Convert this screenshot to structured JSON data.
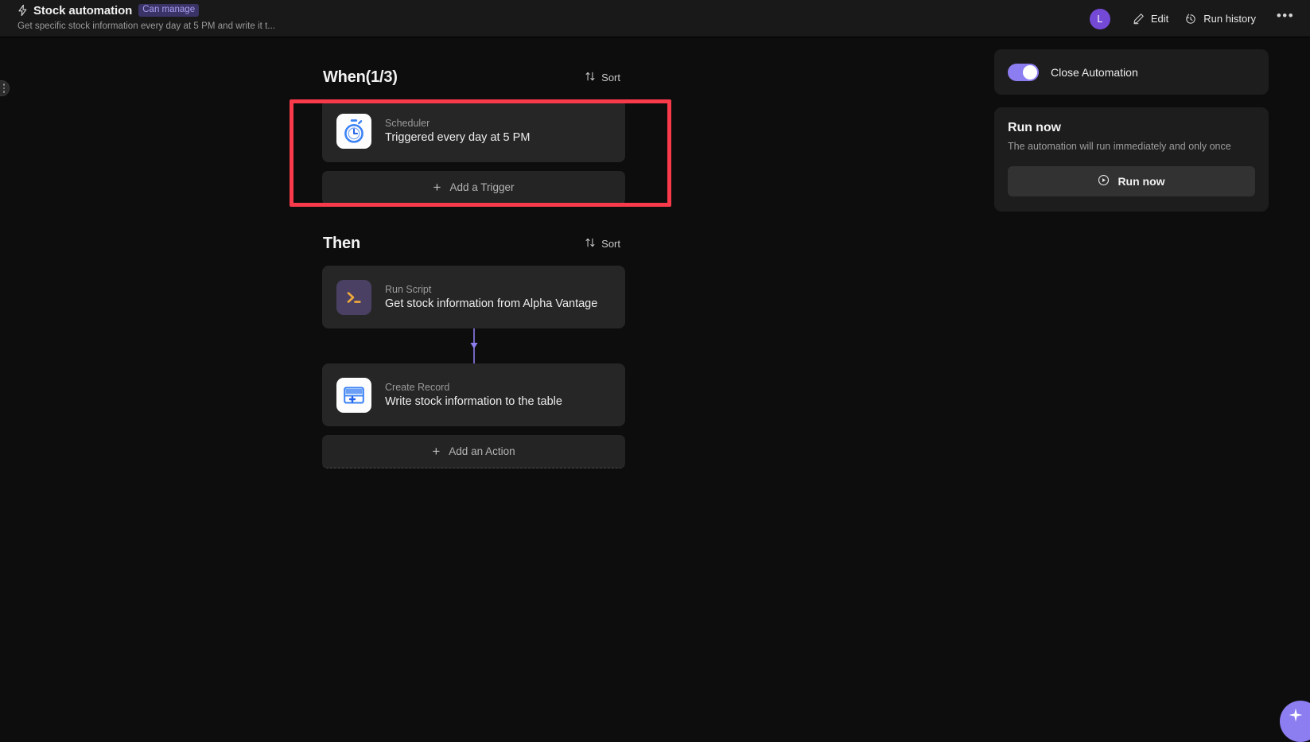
{
  "header": {
    "bolt_icon": "bolt-icon",
    "title": "Stock automation",
    "permission_badge": "Can manage",
    "subtitle": "Get specific stock information every day at 5 PM and write it t...",
    "avatar_initial": "L",
    "edit_label": "Edit",
    "run_history_label": "Run history",
    "more_label": "•••"
  },
  "flow": {
    "when": {
      "heading": "When(1/3)",
      "sort_label": "Sort",
      "triggers": [
        {
          "icon": "stopwatch-icon",
          "kind": "Scheduler",
          "description": "Triggered every day at 5 PM"
        }
      ],
      "add_label": "Add a Trigger",
      "add_plus": "+"
    },
    "then": {
      "heading": "Then",
      "sort_label": "Sort",
      "actions": [
        {
          "icon": "terminal-icon",
          "kind": "Run Script",
          "description": "Get stock information from Alpha Vantage"
        },
        {
          "icon": "create-record-icon",
          "kind": "Create Record",
          "description": "Write stock information to the table"
        }
      ],
      "add_label": "Add an Action",
      "add_plus": "+"
    }
  },
  "right_panel": {
    "toggle_label": "Close Automation",
    "toggle_state": "on",
    "run_now_title": "Run now",
    "run_now_subtitle": "The automation will run immediately and only once",
    "run_now_button": "Run now"
  },
  "fab": {
    "icon": "sparkle-icon"
  },
  "colors": {
    "accent_purple": "#8c7df0",
    "avatar_purple": "#7449d6",
    "highlight_red": "#f93a4a",
    "badge_bg": "#3a3466",
    "badge_text": "#a99cf2",
    "page_bg": "#0d0d0d",
    "topbar_bg": "#191919",
    "card_bg": "#262626",
    "panel_bg": "#1d1d1d"
  }
}
